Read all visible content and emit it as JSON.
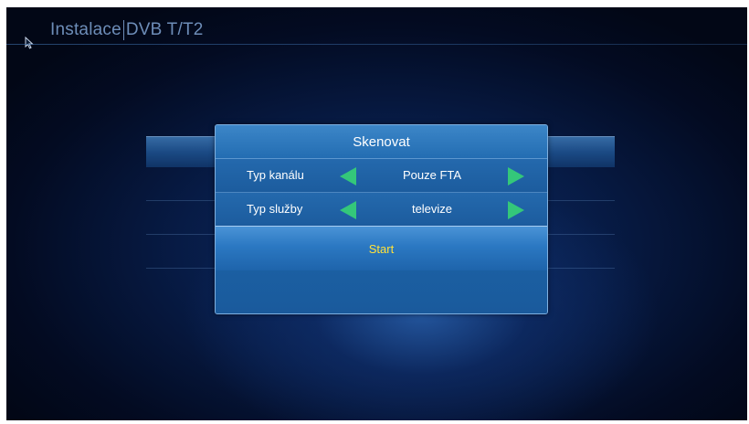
{
  "header": {
    "title_left": "Instalace",
    "title_right": "DVB T/T2"
  },
  "dialog": {
    "title": "Skenovat",
    "rows": [
      {
        "label": "Typ kanálu",
        "value": "Pouze FTA"
      },
      {
        "label": "Typ služby",
        "value": "televize"
      }
    ],
    "start_label": "Start"
  },
  "colors": {
    "accent_arrow": "#34c77a",
    "start_text": "#ffe23a",
    "title_text": "#6d8db8"
  },
  "icons": {
    "cursor": "mouse-pointer-icon",
    "decrease": "left-arrow-icon",
    "increase": "right-arrow-icon"
  }
}
